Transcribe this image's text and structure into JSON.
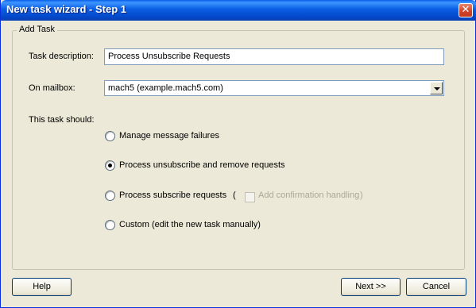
{
  "window": {
    "title": "New task wizard - Step 1",
    "close_glyph": "✕"
  },
  "group": {
    "legend": "Add Task"
  },
  "task_description": {
    "label": "Task description:",
    "value": "Process Unsubscribe Requests"
  },
  "mailbox": {
    "label": "On mailbox:",
    "selected": "mach5 (example.mach5.com)"
  },
  "task_should": {
    "label": "This task should:"
  },
  "options": [
    {
      "label": "Manage message failures",
      "checked": false
    },
    {
      "label": "Process unsubscribe and remove requests",
      "checked": true
    },
    {
      "label": "Process subscribe requests",
      "checked": false
    },
    {
      "label": "Custom (edit the new task manually)",
      "checked": false
    }
  ],
  "confirmation": {
    "open_paren": "(",
    "label": "Add confirmation handling",
    "close_paren": ")",
    "checked": false,
    "enabled": false
  },
  "buttons": {
    "help": "Help",
    "next": "Next >>",
    "cancel": "Cancel"
  },
  "colors": {
    "titlebar": "#0a5de3",
    "window_bg": "#ece9d8",
    "close": "#d2452a"
  }
}
